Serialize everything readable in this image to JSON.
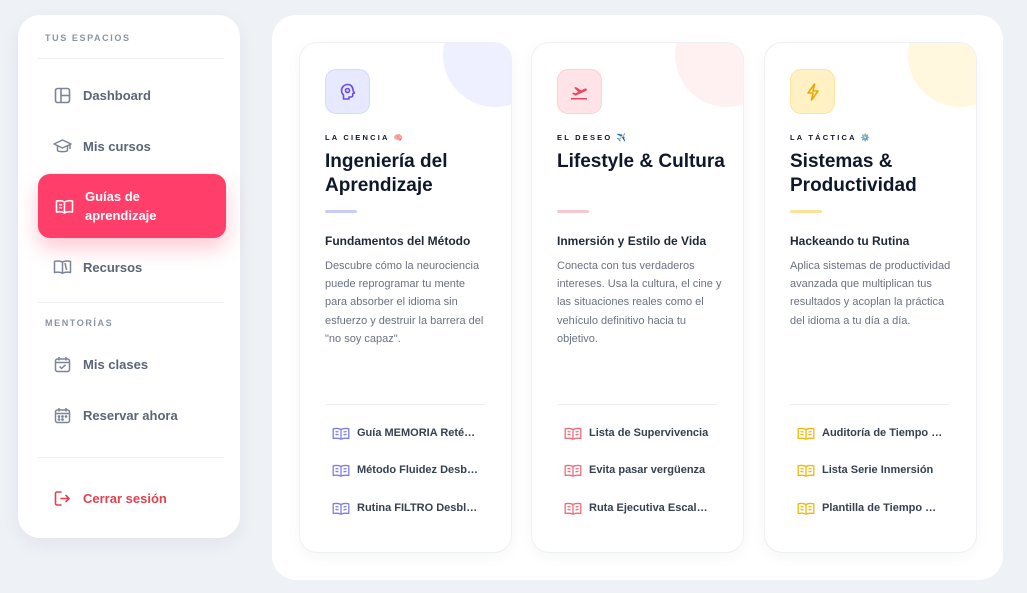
{
  "sidebar": {
    "section_spaces": "TUS ESPACIOS",
    "items": [
      {
        "label": "Dashboard",
        "icon": "layout-icon"
      },
      {
        "label": "Mis cursos",
        "icon": "graduation-cap-icon"
      },
      {
        "label": "Guías de aprendizaje",
        "icon": "open-book-icon",
        "active": true
      },
      {
        "label": "Recursos",
        "icon": "book-shelf-icon"
      }
    ],
    "section_mentoring": "MENTORÍAS",
    "mentoring_items": [
      {
        "label": "Mis clases",
        "icon": "calendar-check-icon"
      },
      {
        "label": "Reservar ahora",
        "icon": "calendar-icon"
      }
    ],
    "logout_label": "Cerrar sesión"
  },
  "cards": [
    {
      "eyebrow": "LA CIENCIA 🧠",
      "title": "Ingeniería del Aprendizaje",
      "subtitle": "Fundamentos del Método",
      "description": "Descubre cómo la neurociencia puede reprogramar tu mente para absorber el idioma sin esfuerzo y destruir la barrera del \"no soy capaz\".",
      "resources": [
        "Guía MEMORIA Reténtiva",
        "Método Fluidez Desbloqueada",
        "Rutina FILTRO Desbloqueo"
      ],
      "color": "#7b7fe6",
      "soft_color": "#e6e9ff",
      "blob_color": "#eef0ff"
    },
    {
      "eyebrow": "EL DESEO ✈️",
      "title": "Lifestyle & Cultura",
      "subtitle": "Inmersión y Estilo de Vida",
      "description": "Conecta con tus verdaderos intereses. Usa la cultura, el cine y las situaciones reales como el vehículo definitivo hacia tu objetivo.",
      "resources": [
        "Lista de Supervivencia",
        "Evita pasar vergüenza",
        "Ruta Ejecutiva Escalable"
      ],
      "color": "#f06b7a",
      "soft_color": "#ffe3e6",
      "blob_color": "#fff0f1"
    },
    {
      "eyebrow": "LA TÁCTICA ⚙️",
      "title": "Sistemas & Productividad",
      "subtitle": "Hackeando tu Rutina",
      "description": "Aplica sistemas de productividad avanzada que multiplican tus resultados y acoplan la práctica del idioma a tu día a día.",
      "resources": [
        "Auditoría de Tiempo Libre",
        "Lista Serie Inmersión",
        "Plantilla de Tiempo Real"
      ],
      "color": "#f2b705",
      "soft_color": "#fff1c4",
      "blob_color": "#fff8df"
    }
  ]
}
